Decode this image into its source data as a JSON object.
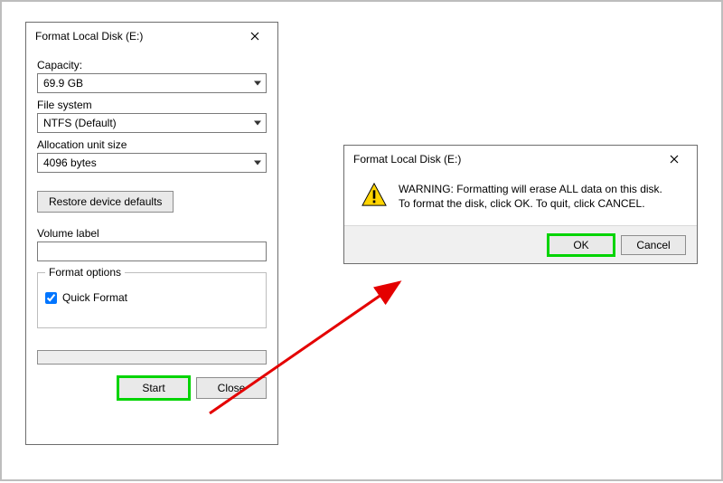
{
  "format_dialog": {
    "title": "Format Local Disk (E:)",
    "capacity_label": "Capacity:",
    "capacity_value": "69.9 GB",
    "fs_label": "File system",
    "fs_value": "NTFS (Default)",
    "aus_label": "Allocation unit size",
    "aus_value": "4096 bytes",
    "restore_btn": "Restore device defaults",
    "volume_label": "Volume label",
    "volume_value": "",
    "options_legend": "Format options",
    "quick_format_label": "Quick Format",
    "quick_format_checked": true,
    "start_btn": "Start",
    "close_btn": "Close"
  },
  "warning_dialog": {
    "title": "Format Local Disk (E:)",
    "message_line1": "WARNING: Formatting will erase ALL data on this disk.",
    "message_line2": "To format the disk, click OK. To quit, click CANCEL.",
    "ok_btn": "OK",
    "cancel_btn": "Cancel"
  }
}
